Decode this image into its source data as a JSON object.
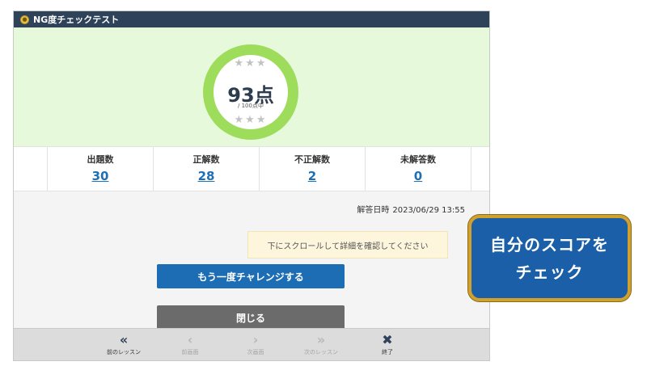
{
  "window": {
    "title": "NG度チェックテスト",
    "title_icon": "medal-icon"
  },
  "score": {
    "value": "93点",
    "sub": "/ 100点中",
    "star_icon": "★"
  },
  "stats": [
    {
      "label": "出題数",
      "value": "30"
    },
    {
      "label": "正解数",
      "value": "28"
    },
    {
      "label": "不正解数",
      "value": "2"
    },
    {
      "label": "未解答数",
      "value": "0"
    }
  ],
  "answer_date": {
    "label": "解答日時",
    "value": "2023/06/29 13:55"
  },
  "notice": "下にスクロールして詳細を確認してください",
  "buttons": {
    "retry": "もう一度チャレンジする",
    "close": "閉じる"
  },
  "footer": {
    "prev_lesson": {
      "icon": "«",
      "label": "前のレッスン"
    },
    "prev_screen": {
      "icon": "‹",
      "label": "前画面"
    },
    "next_screen": {
      "icon": "›",
      "label": "次画面"
    },
    "next_lesson": {
      "icon": "»",
      "label": "次のレッスン"
    },
    "exit": {
      "icon": "✖",
      "label": "終了"
    }
  },
  "callout": {
    "line1": "自分のスコアを",
    "line2": "チェック"
  },
  "colors": {
    "titlebar": "#2e4259",
    "score_bg": "#e6fadb",
    "ring": "#9edc5b",
    "link": "#1f6fb5",
    "primary_button": "#1d6db5",
    "close_button": "#6b6b6b",
    "callout_bg": "#1a5fa8",
    "callout_border": "#d2a12c"
  }
}
